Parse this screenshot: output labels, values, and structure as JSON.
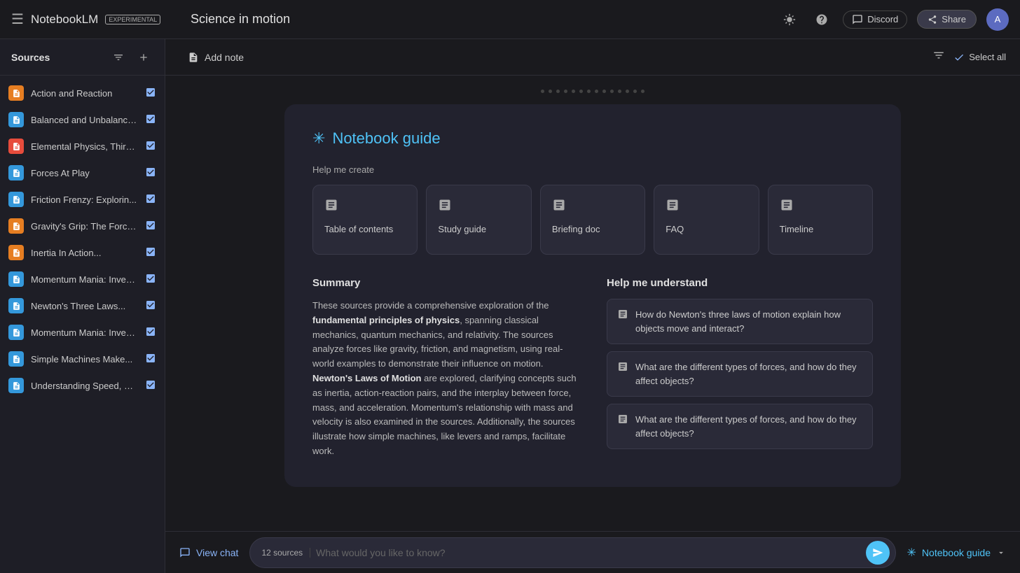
{
  "topbar": {
    "hamburger": "☰",
    "logo": "NotebookLM",
    "badge": "EXPERIMENTAL",
    "notebook_title": "Science in motion",
    "discord_label": "Discord",
    "share_label": "Share",
    "avatar_initials": "A"
  },
  "sidebar": {
    "title": "Sources",
    "filter_icon": "≡",
    "add_icon": "+",
    "items": [
      {
        "name": "Action and Reaction",
        "icon_type": "orange",
        "icon_char": "📄",
        "checked": true
      },
      {
        "name": "Balanced and Unbalance...",
        "icon_type": "blue",
        "icon_char": "📄",
        "checked": true
      },
      {
        "name": "Elemental Physics, Third...",
        "icon_type": "red",
        "icon_char": "📄",
        "checked": true
      },
      {
        "name": "Forces At Play",
        "icon_type": "blue",
        "icon_char": "📄",
        "checked": true
      },
      {
        "name": "Friction Frenzy: Explorin...",
        "icon_type": "blue",
        "icon_char": "📄",
        "checked": true
      },
      {
        "name": "Gravity's Grip: The Force...",
        "icon_type": "orange",
        "icon_char": "📄",
        "checked": true
      },
      {
        "name": "Inertia In Action...",
        "icon_type": "orange",
        "icon_char": "📄",
        "checked": true
      },
      {
        "name": "Momentum Mania: Inves...",
        "icon_type": "blue",
        "icon_char": "📄",
        "checked": true
      },
      {
        "name": "Newton's Three Laws...",
        "icon_type": "blue",
        "icon_char": "📄",
        "checked": true
      },
      {
        "name": "Momentum Mania: Inves...",
        "icon_type": "blue",
        "icon_char": "📄",
        "checked": true
      },
      {
        "name": "Simple Machines Make...",
        "icon_type": "blue",
        "icon_char": "📄",
        "checked": true
      },
      {
        "name": "Understanding Speed, Ve...",
        "icon_type": "blue",
        "icon_char": "📄",
        "checked": true
      }
    ]
  },
  "toolbar": {
    "add_note_label": "Add note",
    "select_all_label": "Select all"
  },
  "notebook_guide": {
    "icon": "✳",
    "title": "Notebook guide",
    "help_create_label": "Help me create",
    "cards": [
      {
        "id": "table-of-contents",
        "label": "Table of contents"
      },
      {
        "id": "study-guide",
        "label": "Study guide"
      },
      {
        "id": "briefing-doc",
        "label": "Briefing doc"
      },
      {
        "id": "faq",
        "label": "FAQ"
      },
      {
        "id": "timeline",
        "label": "Timeline"
      }
    ],
    "summary_title": "Summary",
    "summary_text": "These sources provide a comprehensive exploration of the fundamental principles of physics, spanning classical mechanics, quantum mechanics, and relativity. The sources analyze forces like gravity, friction, and magnetism, using real-world examples to demonstrate their influence on motion. Newton's Laws of Motion are explored, clarifying concepts such as inertia, action-reaction pairs, and the interplay between force, mass, and acceleration. Momentum's relationship with mass and velocity is also examined in the sources. Additionally, the sources illustrate how simple machines, like levers and ramps, facilitate work.",
    "understand_title": "Help me understand",
    "questions": [
      {
        "text": "How do Newton's three laws of motion explain how objects move and interact?"
      },
      {
        "text": "What are the different types of forces, and how do they affect objects?"
      },
      {
        "text": "What are the different types of forces, and how do they affect objects?"
      }
    ]
  },
  "bottom_bar": {
    "view_chat_label": "View chat",
    "sources_badge": "12 sources",
    "input_placeholder": "What would you like to know?",
    "notebook_guide_label": "Notebook guide"
  },
  "dots": [
    1,
    2,
    3,
    4,
    5,
    6,
    7,
    8,
    9,
    10,
    11,
    12,
    13,
    14
  ]
}
